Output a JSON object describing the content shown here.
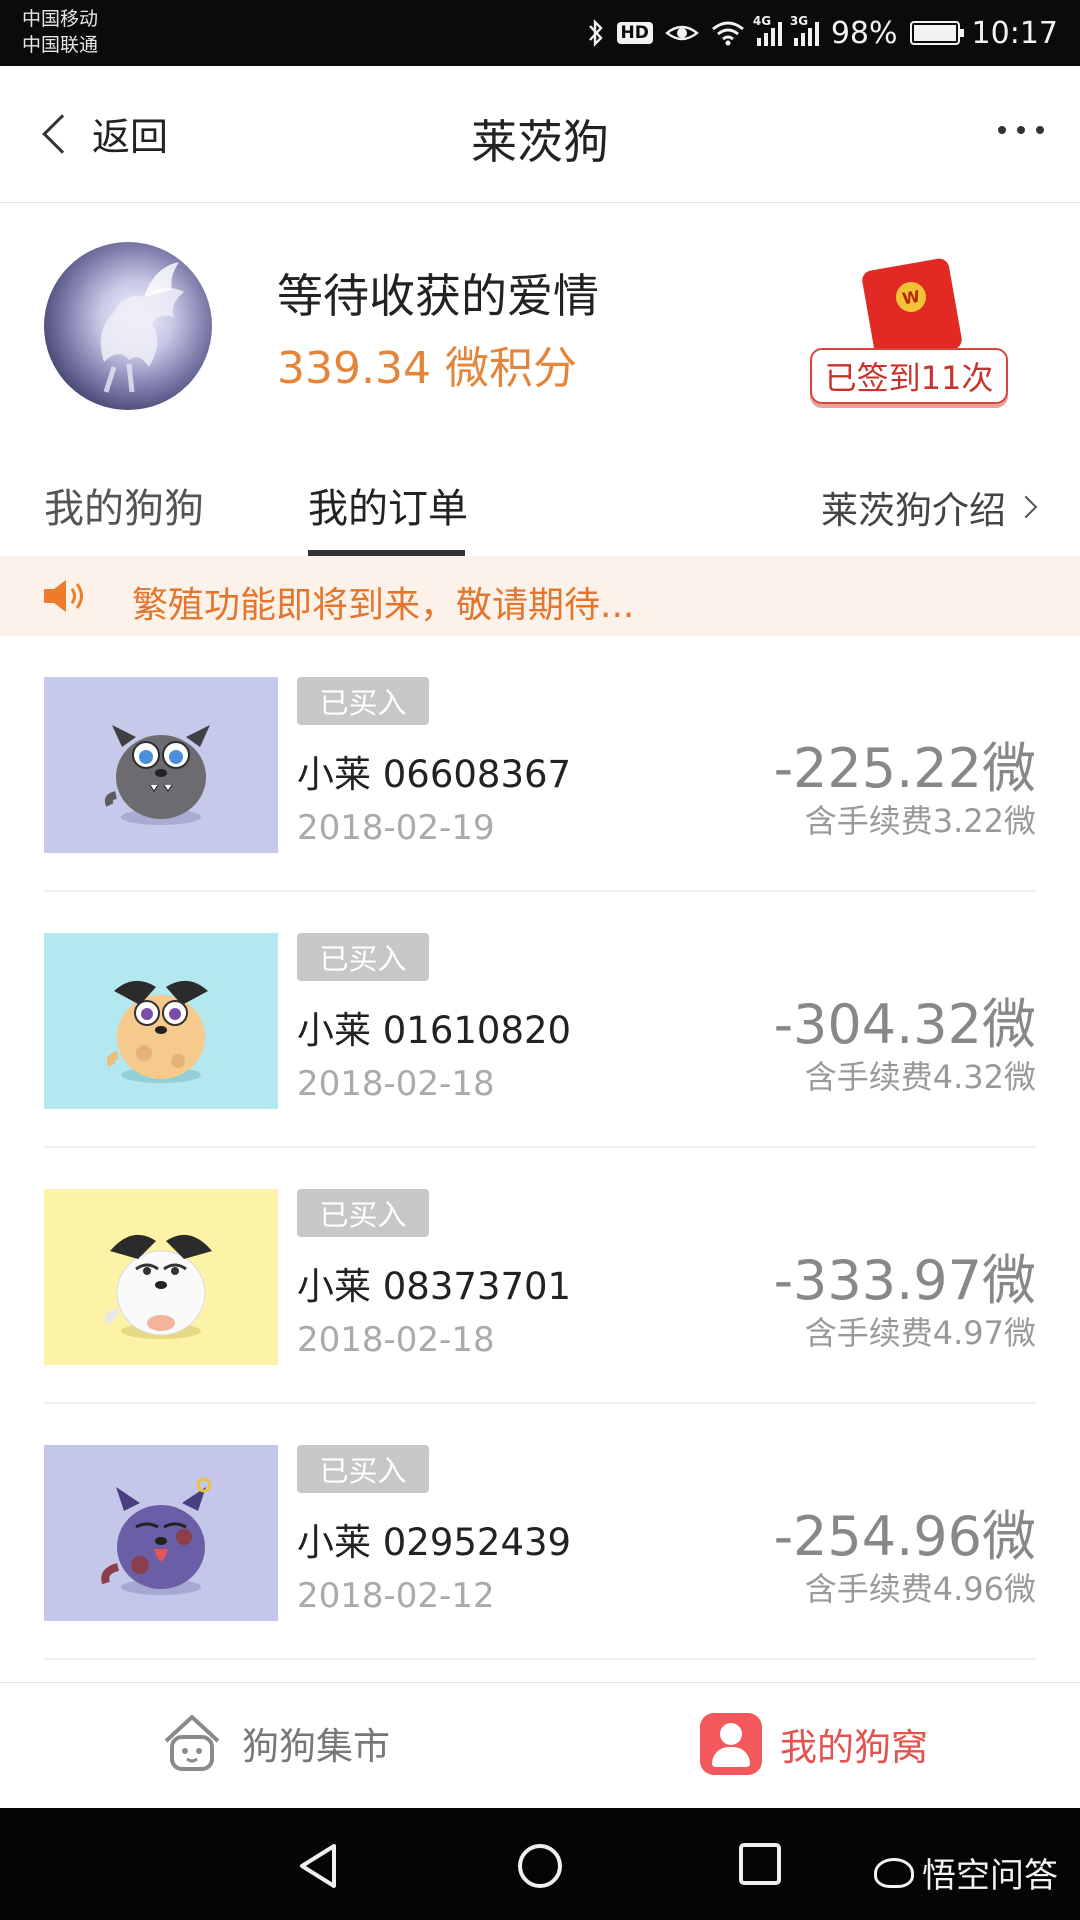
{
  "status_bar": {
    "carrier_1": "中国移动",
    "carrier_2": "中国联通",
    "hd": "HD",
    "net_4g": "4G",
    "net_3g": "3G",
    "battery": "98%",
    "time": "10:17"
  },
  "nav": {
    "back_label": "返回",
    "title": "莱茨狗"
  },
  "profile": {
    "username": "等待收获的爱情",
    "points": "339.34 微积分",
    "checkin": "已签到11次",
    "redpacket_mark": "W"
  },
  "tabs": {
    "my_dogs": "我的狗狗",
    "my_orders": "我的订单",
    "intro": "莱茨狗介绍"
  },
  "notice": {
    "text": "繁殖功能即将到来，敬请期待..."
  },
  "orders": [
    {
      "status": "已买入",
      "name": "小莱 06608367",
      "date": "2018-02-19",
      "price": "-225.22微",
      "fee": "含手续费3.22微",
      "bg_color": "#c7c9ea"
    },
    {
      "status": "已买入",
      "name": "小莱 01610820",
      "date": "2018-02-18",
      "price": "-304.32微",
      "fee": "含手续费4.32微",
      "bg_color": "#b4e8ef"
    },
    {
      "status": "已买入",
      "name": "小莱 08373701",
      "date": "2018-02-18",
      "price": "-333.97微",
      "fee": "含手续费4.97微",
      "bg_color": "#fdf3a6"
    },
    {
      "status": "已买入",
      "name": "小莱 02952439",
      "date": "2018-02-12",
      "price": "-254.96微",
      "fee": "含手续费4.96微",
      "bg_color": "#c4c6ea"
    }
  ],
  "bottom_tabs": {
    "market": "狗狗集市",
    "nest": "我的狗窝"
  },
  "watermark": "悟空问答",
  "colors": {
    "accent_orange": "#e5853a",
    "active_red": "#e4534f",
    "notice_bg": "#fdf2e9"
  }
}
